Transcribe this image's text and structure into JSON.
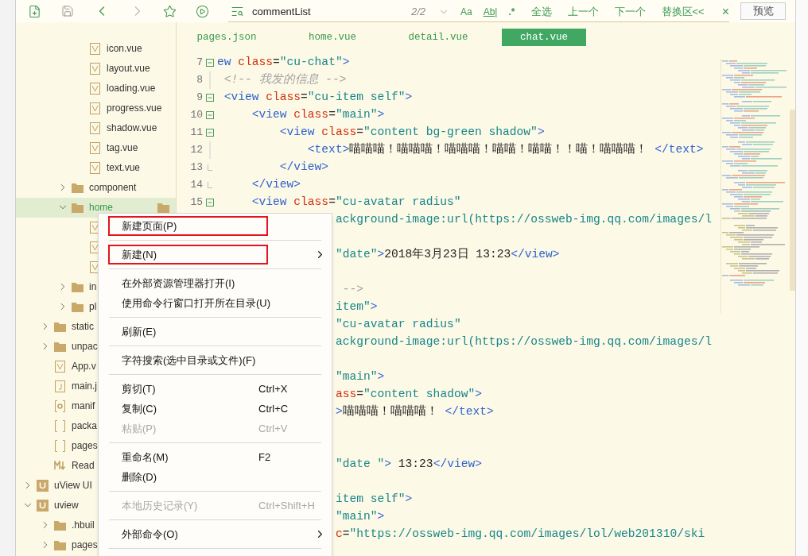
{
  "toolbar": {
    "nav_buttons": [
      {
        "kind": "back",
        "disabled": false
      },
      {
        "kind": "forward",
        "disabled": true
      }
    ],
    "search": {
      "value": "commentList",
      "match_count": "2/2"
    },
    "options": [
      {
        "label": "Aa",
        "kind": "case"
      },
      {
        "label": "Ab|",
        "kind": "word"
      },
      {
        "label": ".*",
        "kind": "regex"
      }
    ],
    "actions": [
      "全选",
      "上一个",
      "下一个",
      "替换区<<"
    ],
    "close": "×",
    "preview": "预览"
  },
  "tree": [
    {
      "children": [
        {
          "children": [
            {
              "children": [
                {
                  "label": "icon.vue",
                  "kind": "vue",
                  "selected": false
                },
                {
                  "label": "layout.vue",
                  "kind": "vue",
                  "selected": false
                },
                {
                  "label": "loading.vue",
                  "kind": "vue",
                  "selected": false
                },
                {
                  "label": "progress.vue",
                  "kind": "vue",
                  "selected": false
                },
                {
                  "label": "shadow.vue",
                  "kind": "vue",
                  "selected": false
                },
                {
                  "label": "tag.vue",
                  "kind": "vue",
                  "selected": false
                },
                {
                  "label": "text.vue",
                  "kind": "vue",
                  "selected": false
                }
              ]
            },
            {
              "label": "component",
              "kind": "folder",
              "expanded": false,
              "selected": false
            },
            {
              "label": "home",
              "kind": "folder",
              "expanded": true,
              "selected": true,
              "children": [
                {
                  "kind": "vue"
                },
                {
                  "kind": "vue"
                },
                {
                  "kind": "vue"
                }
              ]
            },
            {
              "label": "in",
              "kind": "folder",
              "expanded": false,
              "selected": false
            },
            {
              "label": "pl",
              "kind": "folder",
              "expanded": false,
              "selected": false
            }
          ]
        },
        {
          "label": "static",
          "kind": "folder",
          "expanded": false,
          "selected": false
        },
        {
          "label": "unpac",
          "kind": "folder",
          "expanded": false,
          "selected": false
        },
        {
          "label": "App.v",
          "kind": "vue",
          "selected": false
        },
        {
          "label": "main.j",
          "kind": "js",
          "selected": false
        },
        {
          "label": "manif",
          "kind": "gear",
          "selected": false
        },
        {
          "label": "packa",
          "kind": "json",
          "selected": false
        },
        {
          "label": "pages",
          "kind": "json",
          "selected": false
        },
        {
          "label": "Read",
          "kind": "markdown",
          "selected": false
        }
      ]
    },
    {
      "label": "uView UI",
      "kind": "project",
      "expanded": false,
      "selected": false
    },
    {
      "label": "uview",
      "kind": "project",
      "expanded": true,
      "selected": false,
      "children": [
        {
          "label": ".hbuil",
          "kind": "folder",
          "expanded": false,
          "selected": false
        },
        {
          "label": "pages",
          "kind": "folder",
          "expanded": false,
          "selected": false
        }
      ]
    }
  ],
  "tabs": [
    {
      "label": "pages.json",
      "selected": false
    },
    {
      "label": "home.vue",
      "selected": false
    },
    {
      "label": "detail.vue",
      "selected": false
    },
    {
      "label": "chat.vue",
      "selected": true
    }
  ],
  "code_lines": [
    {
      "kind": "full",
      "number": "7",
      "fold": {
        "kind": "start"
      },
      "tokens": [
        {
          "kind": "tag",
          "text": "ew"
        },
        {
          "kind": "attr",
          "text": " class"
        },
        {
          "kind": "op",
          "text": "="
        },
        {
          "kind": "str",
          "text": "\"cu-chat\""
        },
        {
          "kind": "tag",
          "text": ">"
        }
      ]
    },
    {
      "kind": "full",
      "number": "8",
      "fold": {
        "kind": "inner"
      },
      "tokens": [
        {
          "kind": "comment",
          "text": " <!-- 我发的信息 -->"
        }
      ]
    },
    {
      "kind": "full",
      "number": "9",
      "fold": {
        "kind": "start"
      },
      "tokens": [
        {
          "kind": "tag",
          "text": " <view"
        },
        {
          "kind": "attr",
          "text": " class"
        },
        {
          "kind": "op",
          "text": "="
        },
        {
          "kind": "str",
          "text": "\"cu-item self\""
        },
        {
          "kind": "tag",
          "text": ">"
        }
      ]
    },
    {
      "kind": "full",
      "number": "10",
      "fold": {
        "kind": "start"
      },
      "tokens": [
        {
          "kind": "tag",
          "text": "     <view"
        },
        {
          "kind": "attr",
          "text": " class"
        },
        {
          "kind": "op",
          "text": "="
        },
        {
          "kind": "str",
          "text": "\"main\""
        },
        {
          "kind": "tag",
          "text": ">"
        }
      ]
    },
    {
      "kind": "full",
      "number": "11",
      "fold": {
        "kind": "start"
      },
      "tokens": [
        {
          "kind": "tag",
          "text": "         <view"
        },
        {
          "kind": "attr",
          "text": " class"
        },
        {
          "kind": "op",
          "text": "="
        },
        {
          "kind": "str",
          "text": "\"content bg-green shadow\""
        },
        {
          "kind": "tag",
          "text": ">"
        }
      ]
    },
    {
      "kind": "full",
      "number": "12",
      "fold": {
        "kind": "inner"
      },
      "tokens": [
        {
          "kind": "tag",
          "text": "             <text>"
        },
        {
          "kind": "text",
          "text": "喵喵喵！喵喵喵！喵喵喵！喵喵！喵喵！！喵！喵喵喵！"
        },
        {
          "kind": "tag",
          "text": " </text>"
        }
      ]
    },
    {
      "kind": "full",
      "number": "13",
      "fold": {
        "kind": "end"
      },
      "tokens": [
        {
          "kind": "tag",
          "text": "         </view>"
        }
      ]
    },
    {
      "kind": "full",
      "number": "14",
      "fold": {
        "kind": "end"
      },
      "tokens": [
        {
          "kind": "tag",
          "text": "     </view>"
        }
      ]
    },
    {
      "kind": "full",
      "number": "15",
      "fold": {
        "kind": "start"
      },
      "tokens": [
        {
          "kind": "tag",
          "text": "     <view"
        },
        {
          "kind": "attr",
          "text": " class"
        },
        {
          "kind": "op",
          "text": "="
        },
        {
          "kind": "str",
          "text": "\"cu-avatar radius\""
        }
      ]
    },
    {
      "kind": "partial",
      "tokens": [
        {
          "kind": "str",
          "text": "ackground-image:url(https://ossweb-img.qq.com/images/l"
        }
      ]
    },
    {
      "kind": "blank"
    },
    {
      "kind": "partial",
      "tokens": [
        {
          "kind": "str",
          "text": "\"date\""
        },
        {
          "kind": "tag",
          "text": ">"
        },
        {
          "kind": "text",
          "text": "2018年3月23日 13:23"
        },
        {
          "kind": "tag",
          "text": "</view>"
        }
      ]
    },
    {
      "kind": "blank"
    },
    {
      "kind": "partial",
      "tokens": [
        {
          "kind": "comment",
          "text": " -->"
        }
      ]
    },
    {
      "kind": "partial",
      "tokens": [
        {
          "kind": "str",
          "text": "item\""
        },
        {
          "kind": "tag",
          "text": ">"
        }
      ]
    },
    {
      "kind": "partial",
      "tokens": [
        {
          "kind": "str",
          "text": "\"cu-avatar radius\""
        }
      ]
    },
    {
      "kind": "partial",
      "tokens": [
        {
          "kind": "str",
          "text": "ackground-image:url(https://ossweb-img.qq.com/images/l"
        }
      ]
    },
    {
      "kind": "blank"
    },
    {
      "kind": "partial",
      "tokens": [
        {
          "kind": "str",
          "text": "\"main\""
        },
        {
          "kind": "tag",
          "text": ">"
        }
      ]
    },
    {
      "kind": "partial",
      "tokens": [
        {
          "kind": "attr",
          "text": "ass"
        },
        {
          "kind": "op",
          "text": "="
        },
        {
          "kind": "str",
          "text": "\"content shadow\""
        },
        {
          "kind": "tag",
          "text": ">"
        }
      ]
    },
    {
      "kind": "partial",
      "tokens": [
        {
          "kind": "tag",
          "text": ">"
        },
        {
          "kind": "text",
          "text": "喵喵喵！喵喵喵！"
        },
        {
          "kind": "tag",
          "text": " </text>"
        }
      ]
    },
    {
      "kind": "blank"
    },
    {
      "kind": "blank"
    },
    {
      "kind": "partial",
      "tokens": [
        {
          "kind": "str",
          "text": "\"date \""
        },
        {
          "kind": "tag",
          "text": ">"
        },
        {
          "kind": "text",
          "text": " 13:23"
        },
        {
          "kind": "tag",
          "text": "</view>"
        }
      ]
    },
    {
      "kind": "blank"
    },
    {
      "kind": "partial",
      "tokens": [
        {
          "kind": "str",
          "text": "item self\""
        },
        {
          "kind": "tag",
          "text": ">"
        }
      ]
    },
    {
      "kind": "partial",
      "tokens": [
        {
          "kind": "str",
          "text": "\"main\""
        },
        {
          "kind": "tag",
          "text": ">"
        }
      ]
    },
    {
      "kind": "partial",
      "tokens": [
        {
          "kind": "attr",
          "text": "c"
        },
        {
          "kind": "op",
          "text": "="
        },
        {
          "kind": "str",
          "text": "\"https://ossweb-img.qq.com/images/lol/web201310/ski"
        }
      ]
    }
  ],
  "context_menu": [
    [
      {
        "label": "新建页面(P)",
        "highlighted": true,
        "submenu": false,
        "disabled": false
      }
    ],
    [
      {
        "label": "新建(N)",
        "highlighted": true,
        "submenu": true,
        "disabled": false
      }
    ],
    [
      {
        "label": "在外部资源管理器打开(I)",
        "highlighted": false,
        "submenu": false,
        "disabled": false
      },
      {
        "label": "使用命令行窗口打开所在目录(U)",
        "highlighted": false,
        "submenu": false,
        "disabled": false
      }
    ],
    [
      {
        "label": "刷新(E)",
        "highlighted": false,
        "submenu": false,
        "disabled": false
      }
    ],
    [
      {
        "label": "字符搜索(选中目录或文件)(F)",
        "highlighted": false,
        "submenu": false,
        "disabled": false
      }
    ],
    [
      {
        "label": "剪切(T)",
        "shortcut": "Ctrl+X",
        "highlighted": false,
        "submenu": false,
        "disabled": false
      },
      {
        "label": "复制(C)",
        "shortcut": "Ctrl+C",
        "highlighted": false,
        "submenu": false,
        "disabled": false
      },
      {
        "label": "粘贴(P)",
        "shortcut": "Ctrl+V",
        "highlighted": false,
        "submenu": false,
        "disabled": true
      }
    ],
    [
      {
        "label": "重命名(M)",
        "shortcut": "F2",
        "highlighted": false,
        "submenu": false,
        "disabled": false
      },
      {
        "label": "删除(D)",
        "highlighted": false,
        "submenu": false,
        "disabled": false
      }
    ],
    [
      {
        "label": "本地历史记录(Y)",
        "shortcut": "Ctrl+Shift+H",
        "highlighted": false,
        "submenu": false,
        "disabled": true
      }
    ],
    [
      {
        "label": "外部命令(O)",
        "highlighted": false,
        "submenu": true,
        "disabled": false
      }
    ]
  ]
}
